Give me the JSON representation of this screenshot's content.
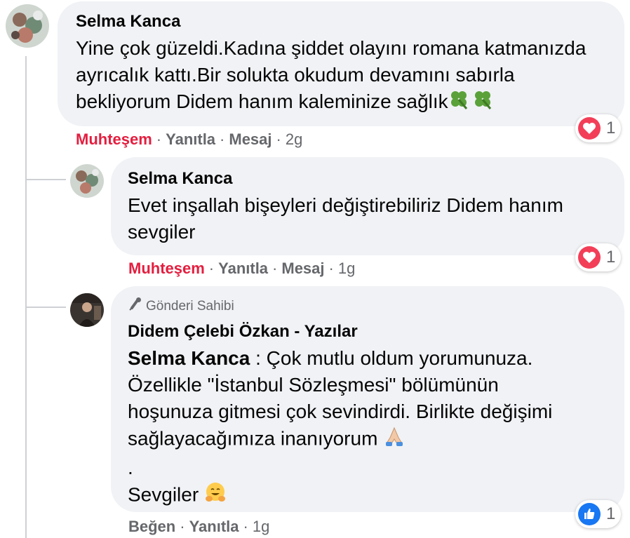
{
  "comments": [
    {
      "author": "Selma Kanca",
      "text": "Yine çok güzeldi.Kadına şiddet olayını romana katmanızda ayrıcalık kattı.Bir solukta okudum devamını sabırla bekliyorum Didem hanım kaleminize sağlık",
      "trailing_emoji": "four-leaf-clover x2",
      "actions": {
        "reaction": "Muhteşem",
        "reply": "Yanıtla",
        "message": "Mesaj",
        "time": "2g"
      },
      "reactions": {
        "icon": "heart-icon",
        "count": "1"
      }
    },
    {
      "author": "Selma Kanca",
      "text": "Evet inşallah bişeyleri değiştirebiliriz Didem hanım sevgiler",
      "actions": {
        "reaction": "Muhteşem",
        "reply": "Yanıtla",
        "message": "Mesaj",
        "time": "1g"
      },
      "reactions": {
        "icon": "heart-icon",
        "count": "1"
      }
    },
    {
      "badge": "Gönderi Sahibi",
      "author": "Didem Çelebi Özkan - Yazılar",
      "mention": "Selma Kanca",
      "text_line1_rest": " : Çok mutlu oldum yorumunuza.",
      "text_line2": "Özellikle \"İstanbul Sözleşmesi\" bölümünün",
      "text_line3": "hoşunuza gitmesi çok sevindirdi. Birlikte değişimi",
      "text_line4": "sağlayacağımıza inanıyorum",
      "text_line5": ".",
      "text_line6": "Sevgiler",
      "actions": {
        "reaction": "Beğen",
        "reply": "Yanıtla",
        "time": "1g"
      },
      "reactions": {
        "icon": "like-icon",
        "count": "1"
      }
    }
  ],
  "colors": {
    "love": "#e41e3f",
    "like": "#1877f2",
    "bubble": "#f0f2f5",
    "meta": "#65676b"
  }
}
